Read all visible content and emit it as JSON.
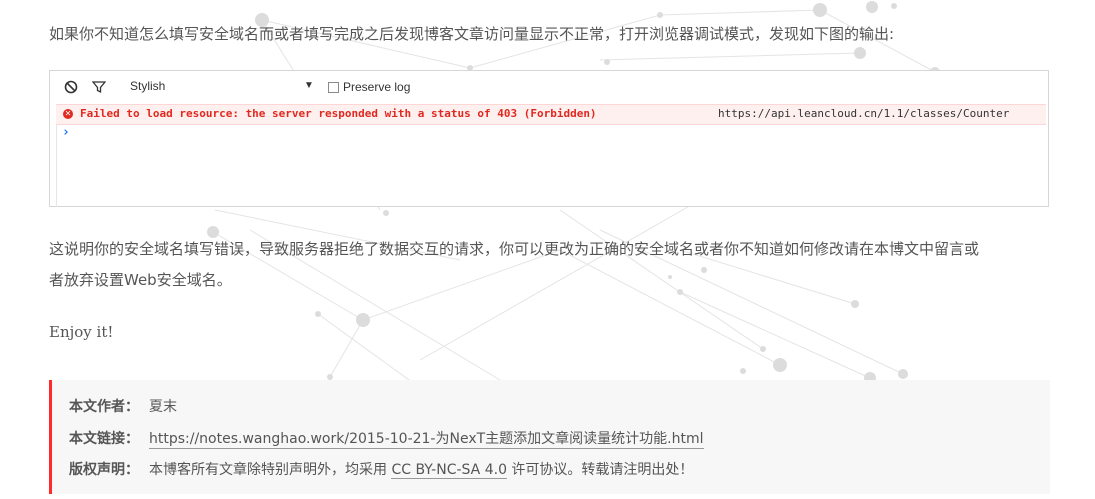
{
  "paragraphs": {
    "p1": "如果你不知道怎么填写安全域名而或者填写完成之后发现博客文章访问量显示不正常，打开浏览器调试模式，发现如下图的输出:",
    "p2_line1": "这说明你的安全域名填写错误，导致服务器拒绝了数据交互的请求，你可以更改为正确的安全域名或者你不知道如何修改请在本博文中留言或",
    "p2_line2": "者放弃设置Web安全域名。",
    "p3": "Enjoy it!"
  },
  "console": {
    "filter_value": "Stylish",
    "preserve_log_label": "Preserve log",
    "preserve_log_checked": false,
    "error_message": "Failed to load resource: the server responded with a status of 403 (Forbidden)",
    "error_url": "https://api.leancloud.cn/1.1/classes/Counter",
    "prompt": "›",
    "icons": {
      "clear": "clear-console-icon",
      "filter": "filter-icon",
      "error": "error-icon"
    }
  },
  "copyright": {
    "author_label": "本文作者：",
    "author": "夏末",
    "link_label": "本文链接：",
    "link": "https://notes.wanghao.work/2015-10-21-为NexT主题添加文章阅读量统计功能.html",
    "license_label": "版权声明：",
    "license_prefix": "本博客所有文章除特别声明外，均采用 ",
    "license_name": "CC BY-NC-SA 4.0",
    "license_suffix": " 许可协议。转载请注明出处！"
  },
  "colors": {
    "text": "#555555",
    "error": "#e0291f",
    "error_bg": "#fff0f0",
    "accent_border": "#ff2a2a",
    "block_bg": "#f7f7f7"
  }
}
